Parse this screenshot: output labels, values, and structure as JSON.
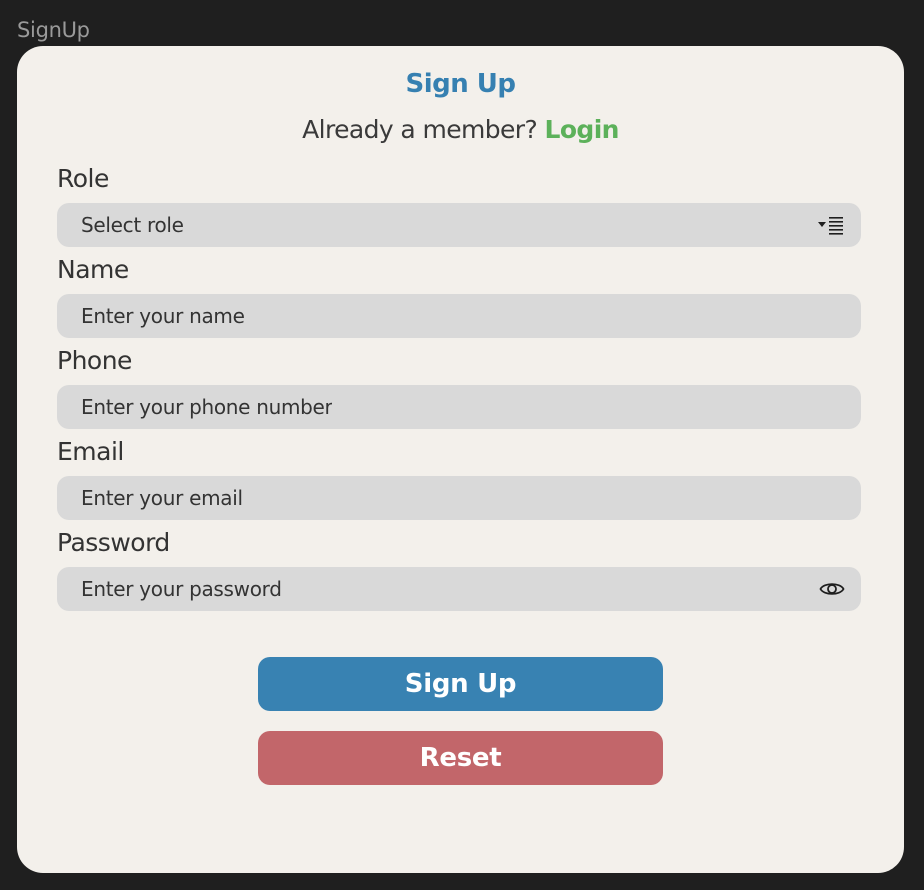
{
  "window": {
    "title": "SignUp"
  },
  "header": {
    "title": "Sign Up",
    "member_prompt": "Already a member?",
    "login_link": "Login"
  },
  "form": {
    "role": {
      "label": "Role",
      "value": "Select role"
    },
    "name": {
      "label": "Name",
      "placeholder": "Enter your name"
    },
    "phone": {
      "label": "Phone",
      "placeholder": "Enter your phone number"
    },
    "email": {
      "label": "Email",
      "placeholder": "Enter your email"
    },
    "password": {
      "label": "Password",
      "placeholder": "Enter your password"
    }
  },
  "actions": {
    "signup_label": "Sign Up",
    "reset_label": "Reset"
  },
  "icons": {
    "dropdown": "dropdown-list-icon",
    "visibility": "eye-icon"
  },
  "colors": {
    "background": "#1f1f1f",
    "card": "#f3f0eb",
    "title": "#3680b1",
    "login_link": "#5cb15a",
    "field": "#d9d9d9",
    "signup_button": "#3882b2",
    "reset_button": "#c2666a"
  }
}
